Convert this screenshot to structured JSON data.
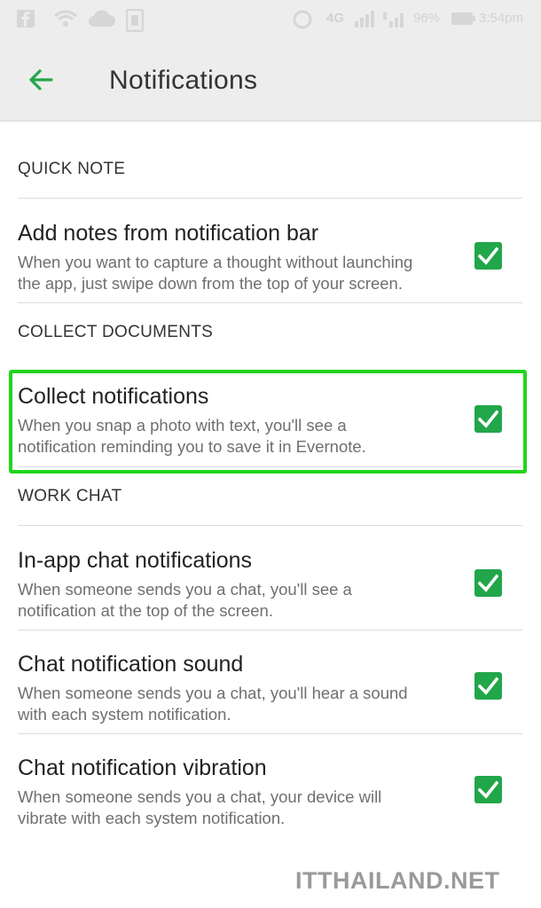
{
  "statusbar": {
    "network": "4G",
    "battery_pct": "96%",
    "time": "3:54pm"
  },
  "appbar": {
    "title": "Notifications",
    "back_icon": "arrow-left-icon"
  },
  "colors": {
    "accent": "#22a64a",
    "highlight": "#22d41c"
  },
  "sections": [
    {
      "header": "QUICK NOTE",
      "items": [
        {
          "title": "Add notes from notification bar",
          "summary_l1": "When you want to capture a thought without launching",
          "summary_l2": "the app, just swipe down from the top of your screen.",
          "checked": true
        }
      ]
    },
    {
      "header": "COLLECT DOCUMENTS",
      "items": [
        {
          "title": "Collect notifications",
          "summary_l1": "When you snap a photo with text, you'll see a",
          "summary_l2": "notification reminding you to save it in Evernote.",
          "checked": true
        }
      ]
    },
    {
      "header": "WORK CHAT",
      "items": [
        {
          "title": "In-app chat notifications",
          "summary_l1": "When someone sends you a chat, you'll see a",
          "summary_l2": "notification at the top of the screen.",
          "checked": true
        },
        {
          "title": "Chat notification sound",
          "summary_l1": "When someone sends you a chat, you'll hear a sound",
          "summary_l2": "with each system notification.",
          "checked": true
        },
        {
          "title": "Chat notification vibration",
          "summary_l1": "When someone sends you a chat, your device will",
          "summary_l2": "vibrate with each system notification.",
          "checked": true
        }
      ]
    }
  ],
  "watermark": "ITTHAILAND.NET"
}
